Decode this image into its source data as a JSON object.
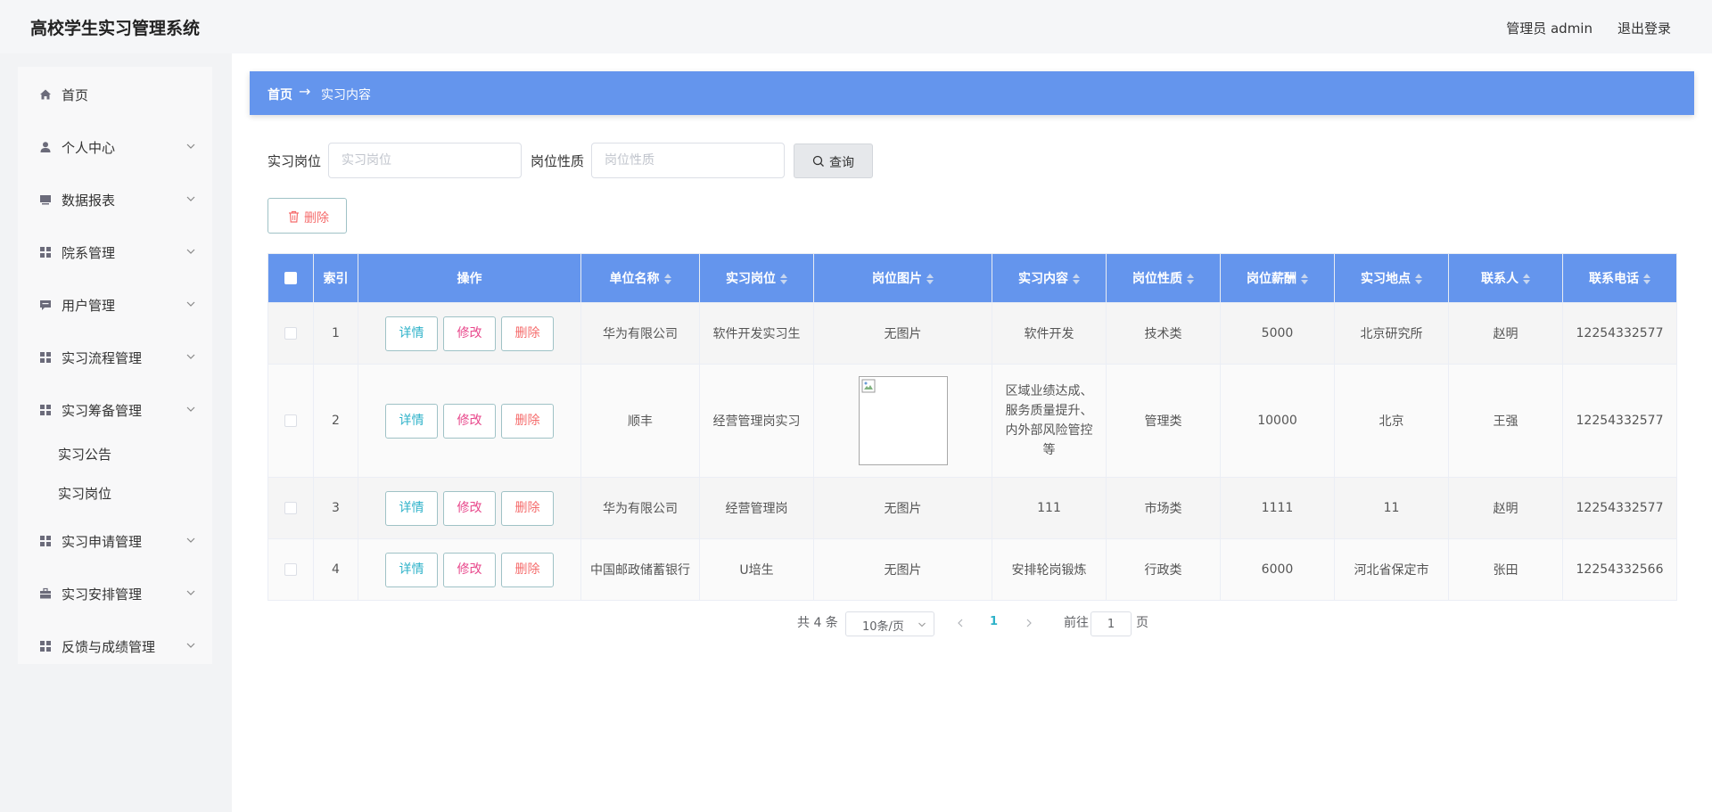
{
  "header": {
    "app_title": "高校学生实习管理系统",
    "admin_name": "管理员 admin",
    "logout_label": "退出登录"
  },
  "sidebar": {
    "items": [
      {
        "label": "首页",
        "icon": "home-icon",
        "has_arrow": false
      },
      {
        "label": "个人中心",
        "icon": "user-icon",
        "has_arrow": true
      },
      {
        "label": "数据报表",
        "icon": "monitor-icon",
        "has_arrow": true
      },
      {
        "label": "院系管理",
        "icon": "grid-icon",
        "has_arrow": true
      },
      {
        "label": "用户管理",
        "icon": "chat-icon",
        "has_arrow": true
      },
      {
        "label": "实习流程管理",
        "icon": "grid-icon",
        "has_arrow": true
      },
      {
        "label": "实习筹备管理",
        "icon": "grid-icon",
        "has_arrow": true,
        "expanded": true
      },
      {
        "label": "实习申请管理",
        "icon": "grid-icon",
        "has_arrow": true
      },
      {
        "label": "实习安排管理",
        "icon": "briefcase-icon",
        "has_arrow": true
      },
      {
        "label": "反馈与成绩管理",
        "icon": "grid-icon",
        "has_arrow": true
      }
    ],
    "sub_items": [
      "实习公告",
      "实习岗位"
    ]
  },
  "breadcrumb": {
    "home": "首页",
    "arrow": "→",
    "current": "实习内容"
  },
  "filters": {
    "position_label": "实习岗位",
    "position_placeholder": "实习岗位",
    "nature_label": "岗位性质",
    "nature_placeholder": "岗位性质",
    "search_label": "查询",
    "delete_label": "删除"
  },
  "table": {
    "columns": [
      "索引",
      "操作",
      "单位名称",
      "实习岗位",
      "岗位图片",
      "实习内容",
      "岗位性质",
      "岗位薪酬",
      "实习地点",
      "联系人",
      "联系电话"
    ],
    "action_labels": {
      "detail": "详情",
      "edit": "修改",
      "delete": "删除"
    },
    "rows": [
      {
        "index": "1",
        "company": "华为有限公司",
        "position": "软件开发实习生",
        "image": "无图片",
        "content": "软件开发",
        "nature": "技术类",
        "salary": "5000",
        "location": "北京研究所",
        "contact": "赵明",
        "phone": "12254332577"
      },
      {
        "index": "2",
        "company": "顺丰",
        "position": "经营管理岗实习",
        "image": "",
        "content": "区域业绩达成、服务质量提升、内外部风险管控等",
        "nature": "管理类",
        "salary": "10000",
        "location": "北京",
        "contact": "王强",
        "phone": "12254332577"
      },
      {
        "index": "3",
        "company": "华为有限公司",
        "position": "经营管理岗",
        "image": "无图片",
        "content": "111",
        "nature": "市场类",
        "salary": "1111",
        "location": "11",
        "contact": "赵明",
        "phone": "12254332577"
      },
      {
        "index": "4",
        "company": "中国邮政储蓄银行",
        "position": "U培生",
        "image": "无图片",
        "content": "安排轮岗锻炼",
        "nature": "行政类",
        "salary": "6000",
        "location": "河北省保定市",
        "contact": "张田",
        "phone": "12254332566"
      }
    ]
  },
  "pagination": {
    "total": "共 4 条",
    "page_size": "10条/页",
    "current_page": "1",
    "goto_prefix": "前往",
    "goto_value": "1",
    "goto_suffix": "页"
  }
}
